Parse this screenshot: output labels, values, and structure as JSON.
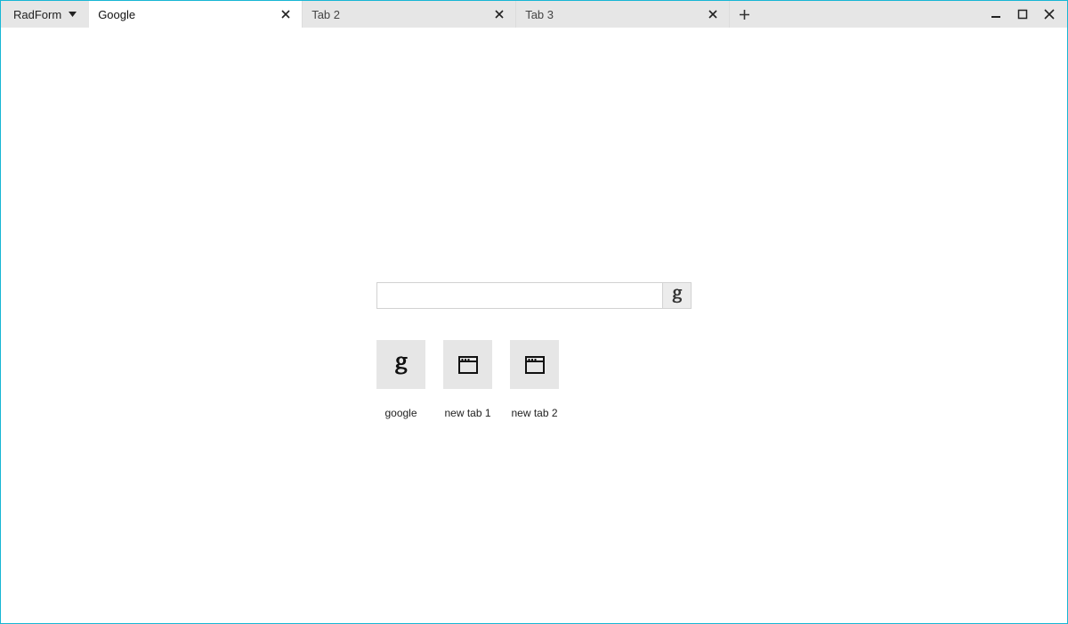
{
  "app": {
    "menu_label": "RadForm"
  },
  "tabs": [
    {
      "label": "Google",
      "active": true
    },
    {
      "label": "Tab 2",
      "active": false
    },
    {
      "label": "Tab 3",
      "active": false
    }
  ],
  "search": {
    "value": "",
    "placeholder": ""
  },
  "tiles": [
    {
      "label": "google",
      "icon": "google-g"
    },
    {
      "label": "new tab 1",
      "icon": "window"
    },
    {
      "label": "new tab 2",
      "icon": "window"
    }
  ]
}
